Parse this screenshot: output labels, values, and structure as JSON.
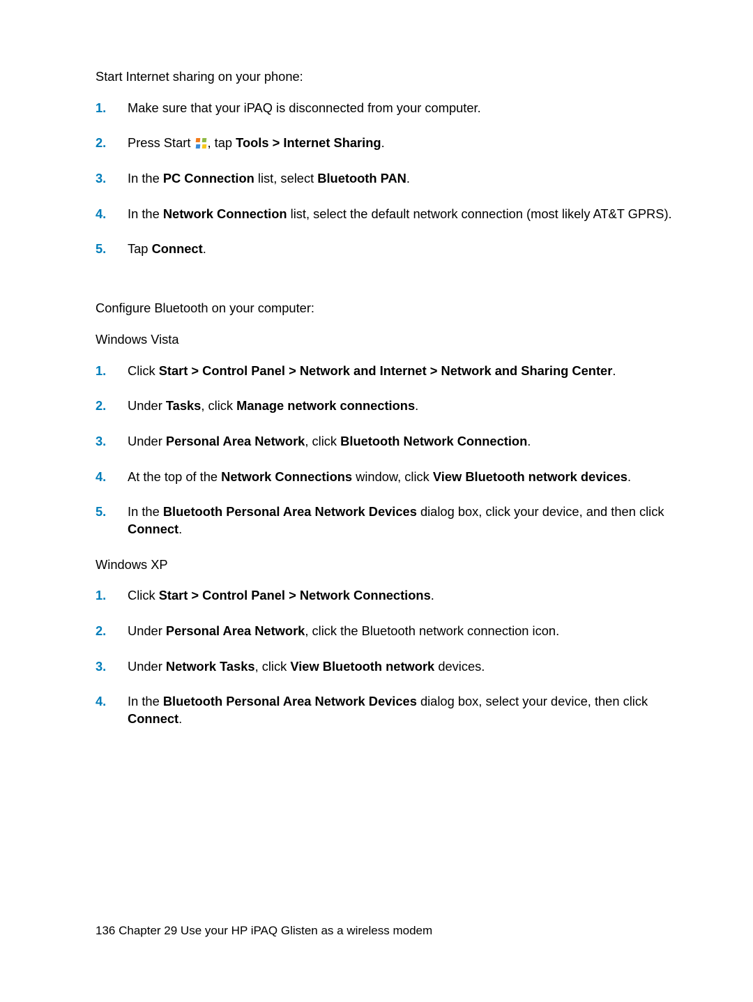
{
  "section1": {
    "intro": "Start Internet sharing on your phone:",
    "items": [
      {
        "num": "1.",
        "pre": "Make sure that your iPAQ is disconnected from your computer."
      },
      {
        "num": "2.",
        "pre": "Press Start ",
        "icon": true,
        "post1": ", tap ",
        "b1": "Tools > Internet Sharing",
        "post2": "."
      },
      {
        "num": "3.",
        "pre": "In the ",
        "b1": "PC Connection",
        "mid": " list, select ",
        "b2": "Bluetooth PAN",
        "post": "."
      },
      {
        "num": "4.",
        "pre": "In the ",
        "b1": "Network Connection",
        "post": " list, select the default network connection (most likely AT&T GPRS)."
      },
      {
        "num": "5.",
        "pre": "Tap ",
        "b1": "Connect",
        "post": "."
      }
    ]
  },
  "section2": {
    "intro": "Configure Bluetooth on your computer:",
    "sub1": "Windows Vista",
    "vista": [
      {
        "num": "1.",
        "pre": "Click ",
        "b1": "Start > Control Panel > Network and Internet > Network and Sharing Center",
        "post": "."
      },
      {
        "num": "2.",
        "pre": "Under ",
        "b1": "Tasks",
        "mid": ", click ",
        "b2": "Manage network connections",
        "post": "."
      },
      {
        "num": "3.",
        "pre": "Under ",
        "b1": "Personal Area Network",
        "mid": ", click ",
        "b2": "Bluetooth Network Connection",
        "post": "."
      },
      {
        "num": "4.",
        "pre": "At the top of the ",
        "b1": "Network Connections",
        "mid": " window, click ",
        "b2": "View Bluetooth network devices",
        "post": "."
      },
      {
        "num": "5.",
        "pre": "In the ",
        "b1": "Bluetooth Personal Area Network Devices",
        "mid": " dialog box, click your device, and then click ",
        "b2": "Connect",
        "post": "."
      }
    ],
    "sub2": "Windows XP",
    "xp": [
      {
        "num": "1.",
        "pre": "Click ",
        "b1": "Start > Control Panel > Network Connections",
        "post": "."
      },
      {
        "num": "2.",
        "pre": "Under ",
        "b1": "Personal Area Network",
        "post": ", click the Bluetooth network connection icon."
      },
      {
        "num": "3.",
        "pre": "Under ",
        "b1": "Network Tasks",
        "mid": ", click ",
        "b2": "View Bluetooth network",
        "post": " devices."
      },
      {
        "num": "4.",
        "pre": "In the ",
        "b1": "Bluetooth Personal Area Network Devices",
        "mid": " dialog box, select your device, then click ",
        "b2": "Connect",
        "post": "."
      }
    ]
  },
  "footer": "136   Chapter 29   Use your HP iPAQ Glisten as a wireless modem"
}
